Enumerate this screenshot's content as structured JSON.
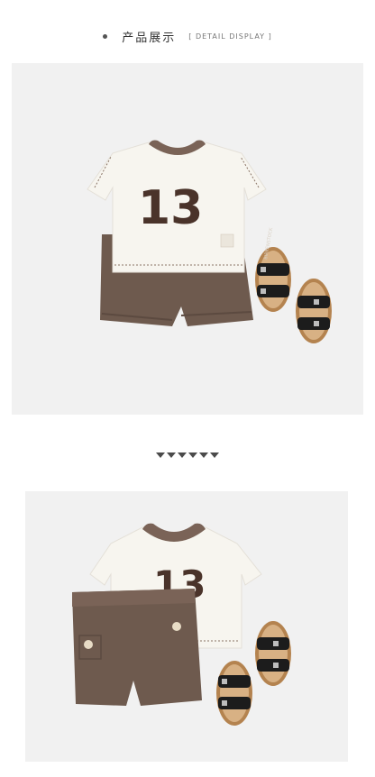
{
  "header": {
    "title_cn": "产品展示",
    "title_en": "[ DETAIL DISPLAY ]"
  },
  "product": {
    "shirt_number": "13"
  },
  "divider": {
    "arrow_count": 6
  },
  "colors": {
    "background": "#f1f1f1",
    "shirt": "#f7f5ef",
    "collar": "#7a6357",
    "shorts": "#6e5a4e",
    "number": "#4a332a",
    "sandal_strap": "#1c1c1c",
    "sandal_sole": "#b4834f"
  }
}
